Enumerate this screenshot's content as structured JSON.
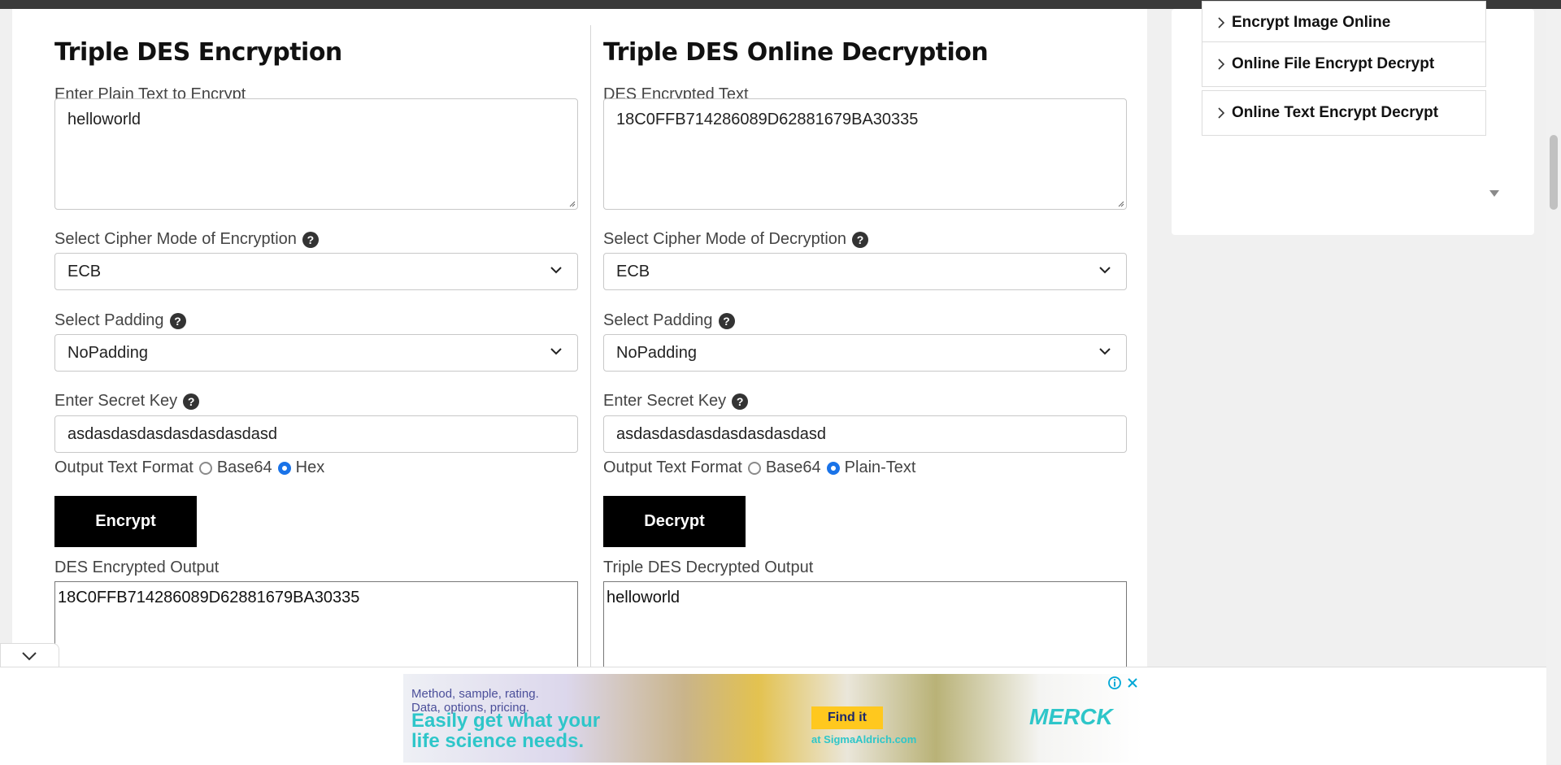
{
  "encryption": {
    "title": "Triple DES Encryption",
    "plaintext_label": "Enter Plain Text to Encrypt",
    "plaintext_value": "helloworld",
    "mode_label": "Select Cipher Mode of Encryption",
    "mode_value": "ECB",
    "padding_label": "Select Padding",
    "padding_value": "NoPadding",
    "key_label": "Enter Secret Key",
    "key_value": "asdasdasdasdasdasdasdasd",
    "format_label": "Output Text Format",
    "format_options": [
      "Base64",
      "Hex"
    ],
    "format_selected": "Hex",
    "button_label": "Encrypt",
    "output_label": "DES Encrypted Output",
    "output_value": "18C0FFB714286089D62881679BA30335"
  },
  "decryption": {
    "title": "Triple DES Online Decryption",
    "ciphertext_label": "DES Encrypted Text",
    "ciphertext_value": "18C0FFB714286089D62881679BA30335",
    "mode_label": "Select Cipher Mode of Decryption",
    "mode_value": "ECB",
    "padding_label": "Select Padding",
    "padding_value": "NoPadding",
    "key_label": "Enter Secret Key",
    "key_value": "asdasdasdasdasdasdasdasd",
    "format_label": "Output Text Format",
    "format_options": [
      "Base64",
      "Plain-Text"
    ],
    "format_selected": "Plain-Text",
    "button_label": "Decrypt",
    "output_label": "Triple DES Decrypted Output",
    "output_value": "helloworld"
  },
  "help_glyph": "?",
  "sidebar": {
    "items": [
      {
        "label": "Encrypt Image Online"
      },
      {
        "label": "Online File Encrypt Decrypt"
      },
      {
        "label": "Online Text Encrypt Decrypt"
      }
    ]
  },
  "ad": {
    "small_text_1": "Method, sample, rating.",
    "small_text_2": "Data, options, pricing.",
    "headline_1": "Easily get what your",
    "headline_2": "life science needs.",
    "cta_label": "Find it",
    "cta_sub": "at SigmaAldrich.com",
    "brand": "MERCK"
  },
  "colors": {
    "accent_radio": "#1a73e8",
    "button_bg": "#000000",
    "ad_teal": "#2ec6c9",
    "ad_cta": "#ffc81e"
  },
  "icons": [
    "help-icon",
    "chevron-down-icon",
    "chevron-right-icon",
    "ad-info-icon",
    "ad-close-icon",
    "scroll-down-icon"
  ]
}
